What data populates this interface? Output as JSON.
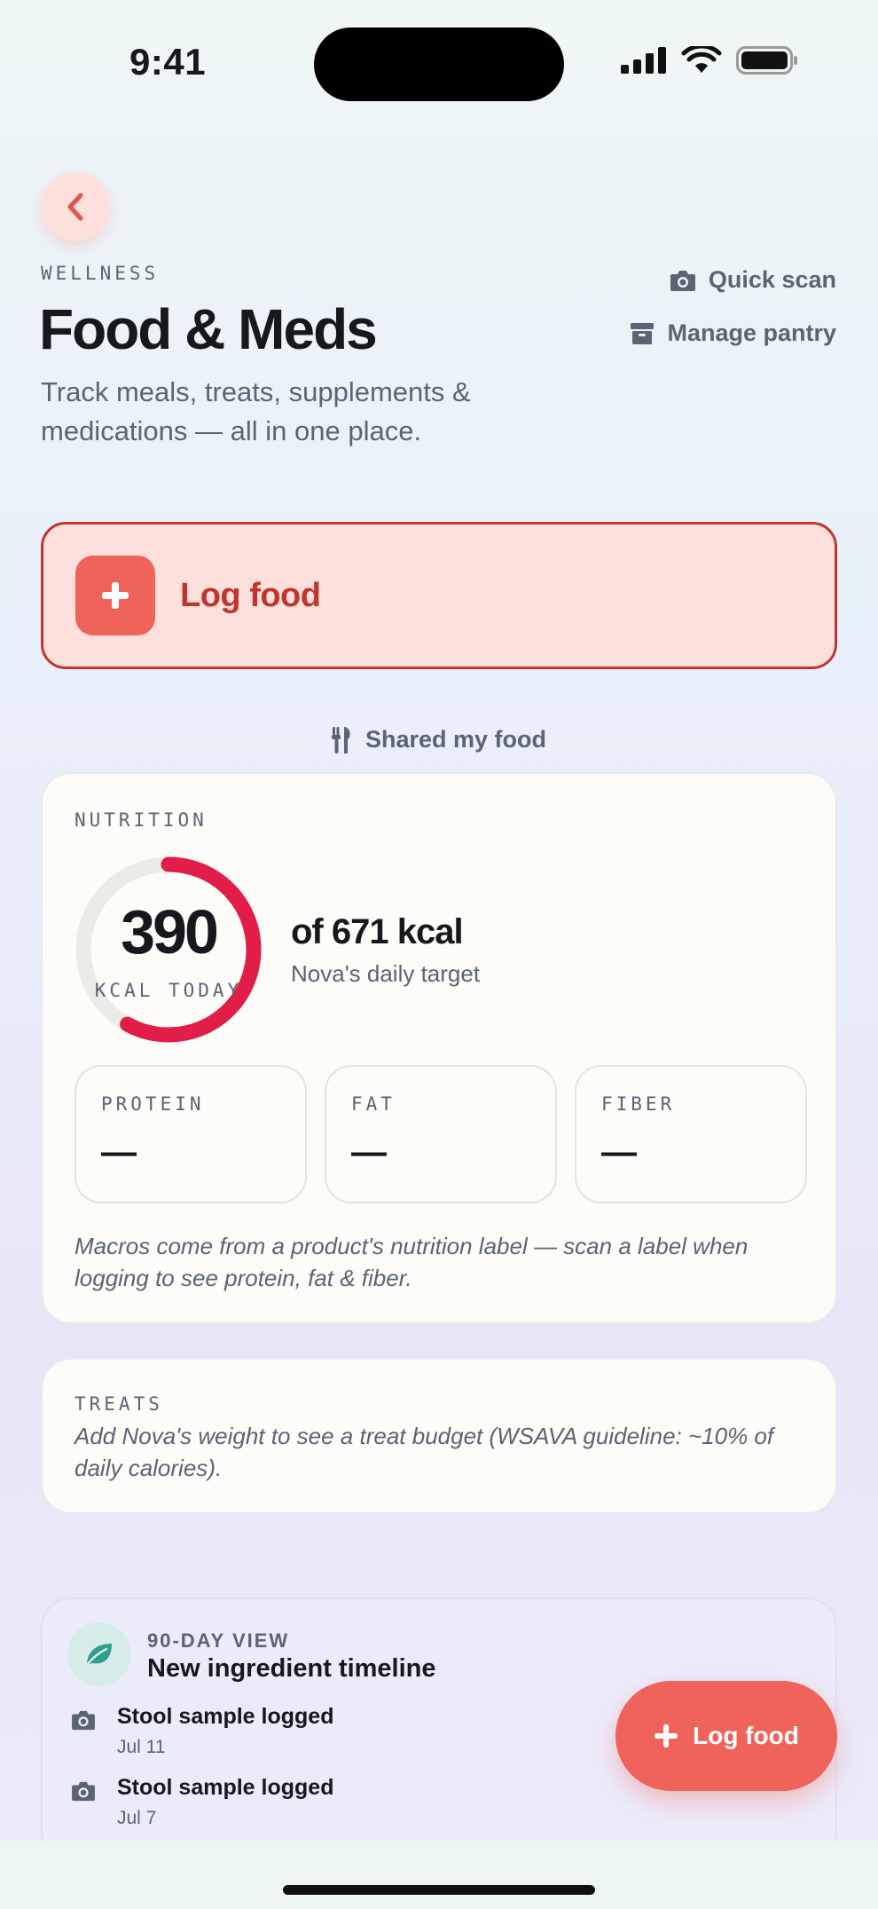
{
  "status_bar": {
    "time": "9:41"
  },
  "header": {
    "eyebrow": "WELLNESS",
    "title": "Food & Meds",
    "subtitle": "Track meals, treats, supplements & medications — all in one place.",
    "quick_scan": "Quick scan",
    "manage_pantry": "Manage pantry"
  },
  "log_food_card": {
    "label": "Log food"
  },
  "shared_link": {
    "label": "Shared my food"
  },
  "nutrition": {
    "eyebrow": "NUTRITION",
    "kcal_today": "390",
    "kcal_today_label": "KCAL TODAY",
    "kcal_progress": 0.58,
    "target": "of 671 kcal",
    "target_sub": "Nova's daily target",
    "macros": [
      {
        "label": "PROTEIN",
        "value": "—"
      },
      {
        "label": "FAT",
        "value": "—"
      },
      {
        "label": "FIBER",
        "value": "—"
      }
    ],
    "note": "Macros come from a product's nutrition label — scan a label when logging to see protein, fat & fiber."
  },
  "treats": {
    "eyebrow": "TREATS",
    "text": "Add Nova's weight to see a treat budget (WSAVA guideline: ~10% of daily calories)."
  },
  "timeline": {
    "eyebrow": "90-DAY VIEW",
    "title": "New ingredient timeline",
    "items": [
      {
        "title": "Stool sample logged",
        "date": "Jul 11"
      },
      {
        "title": "Stool sample logged",
        "date": "Jul 7"
      }
    ]
  },
  "fab": {
    "label": "Log food"
  },
  "colors": {
    "accent": "#f0635a",
    "accent_dark": "#c0362c",
    "ring": "#e11d48",
    "muted": "#5b6472"
  }
}
